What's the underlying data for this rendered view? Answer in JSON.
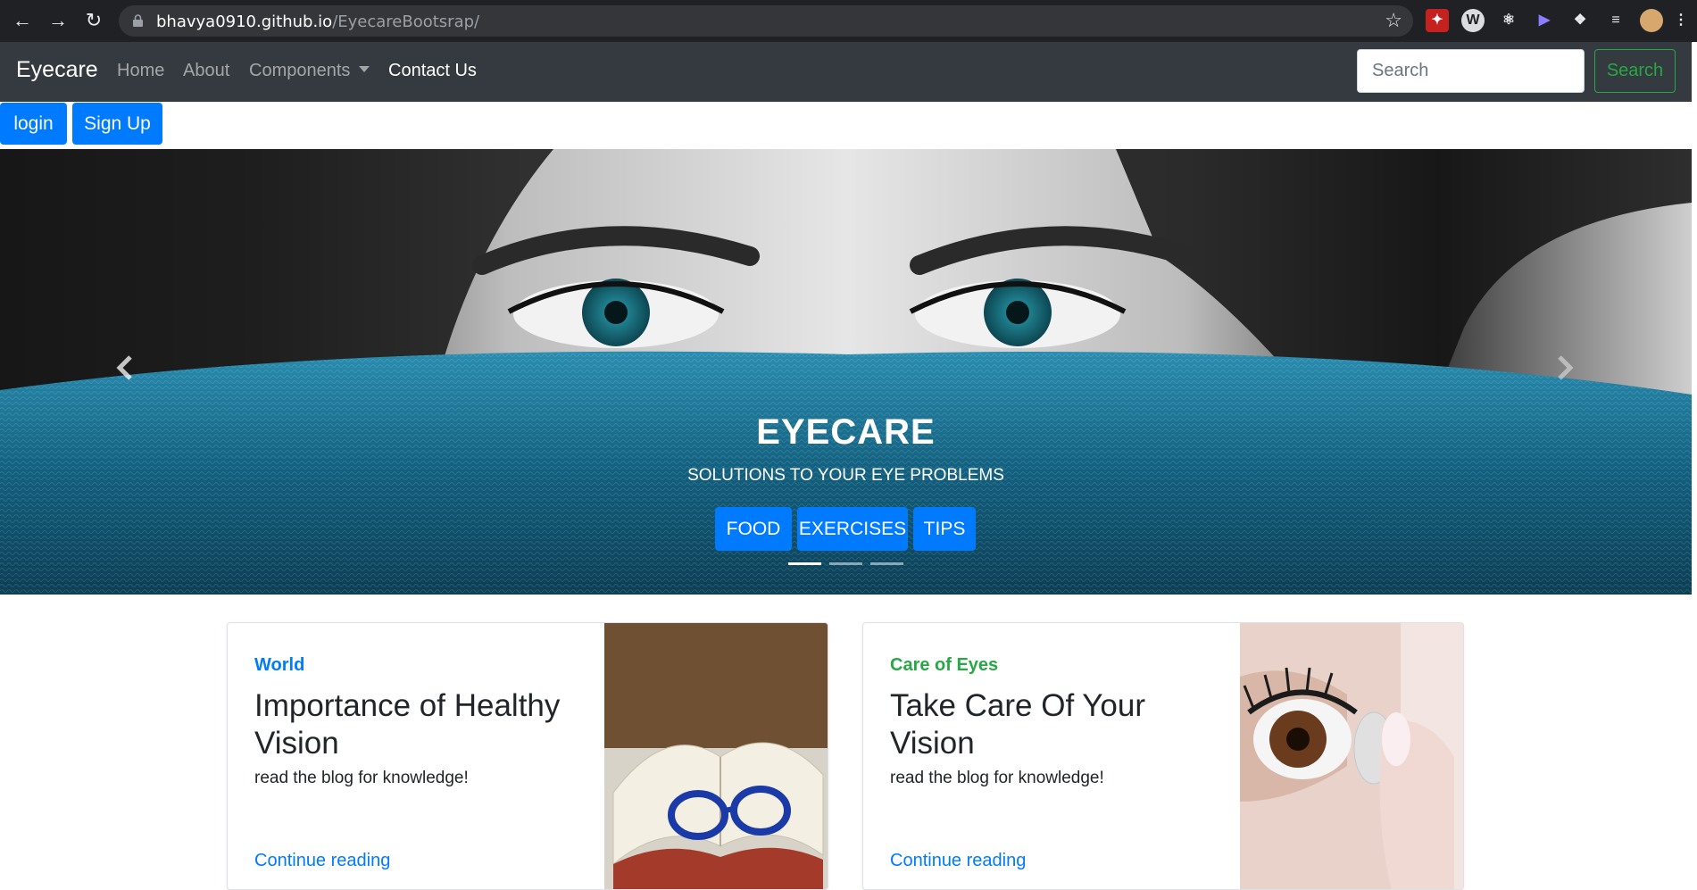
{
  "browser": {
    "url_host": "bhavya0910.github.io",
    "url_path": "/EyecareBootsrap/"
  },
  "navbar": {
    "brand": "Eyecare",
    "links": [
      "Home",
      "About",
      "Components",
      "Contact Us"
    ],
    "search_placeholder": "Search",
    "search_button": "Search"
  },
  "auth": {
    "login": "login",
    "signup": "Sign Up"
  },
  "carousel": {
    "title": "EYECARE",
    "subtitle": "SOLUTIONS TO YOUR EYE PROBLEMS",
    "buttons": [
      "FOOD",
      "EXERCISES",
      "TIPS"
    ],
    "active_slide": 1,
    "slide_count": 3
  },
  "cards": [
    {
      "category": "World",
      "category_color": "#007bff",
      "title": "Importance of Healthy Vision",
      "description": "read the blog for knowledge!",
      "link": "Continue reading"
    },
    {
      "category": "Care of Eyes",
      "category_color": "#28a745",
      "title": "Take Care Of Your Vision",
      "description": "read the blog for knowledge!",
      "link": "Continue reading"
    }
  ],
  "colors": {
    "primary": "#007bff",
    "success": "#28a745",
    "navbar": "#343a40"
  }
}
